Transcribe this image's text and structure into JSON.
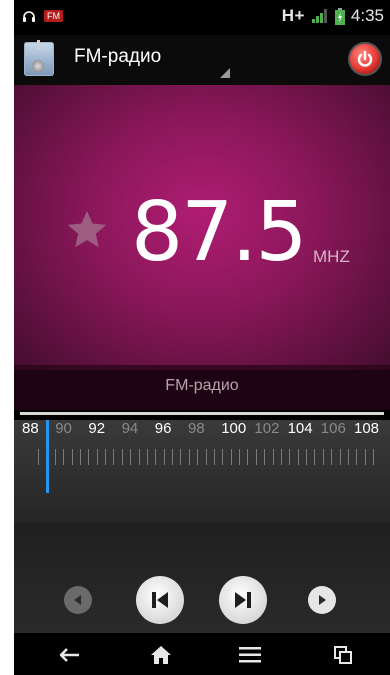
{
  "status_bar": {
    "notification_badge": "FM",
    "network_type": "H+",
    "time": "4:35"
  },
  "action_bar": {
    "title": "FM-радио",
    "icons": {
      "app": "radio-app-icon",
      "power": "power-icon"
    }
  },
  "tuner": {
    "frequency": "87.5",
    "unit": "MHZ",
    "favorite": false,
    "station_name": "FM-радио",
    "accent_color": "#b01d72"
  },
  "scale": {
    "labels": [
      {
        "text": "88",
        "major": true
      },
      {
        "text": "90",
        "major": false
      },
      {
        "text": "92",
        "major": true
      },
      {
        "text": "94",
        "major": false
      },
      {
        "text": "96",
        "major": true
      },
      {
        "text": "98",
        "major": false
      },
      {
        "text": "100",
        "major": true
      },
      {
        "text": "102",
        "major": false
      },
      {
        "text": "104",
        "major": true
      },
      {
        "text": "106",
        "major": false
      },
      {
        "text": "108",
        "major": true
      }
    ],
    "needle_color": "#2196f3"
  },
  "controls": {
    "icons": [
      "prev-small-icon",
      "seek-back-icon",
      "seek-forward-icon",
      "next-small-icon"
    ]
  },
  "nav": {
    "icons": [
      "back-icon",
      "home-icon",
      "menu-icon",
      "recent-apps-icon"
    ]
  }
}
